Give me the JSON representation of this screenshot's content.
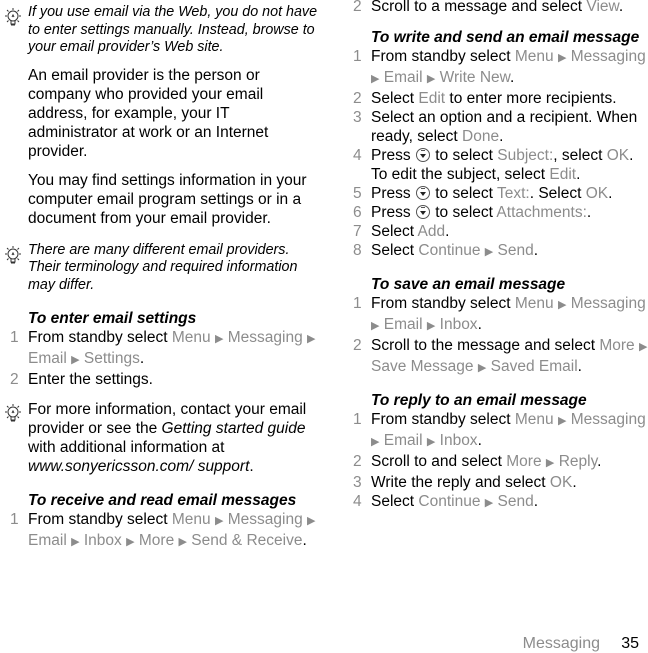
{
  "footer": {
    "section": "Messaging",
    "page_number": "35"
  },
  "left_column": {
    "tip1": "If you use email via the Web, you do not have to enter settings manually. Instead, browse to your email provider’s Web site.",
    "para1": "An email provider is the person or company who provided your email address, for example, your IT administrator at work or an Internet provider.",
    "para2": "You may find settings information in your computer email program settings or in a document from your email provider.",
    "tip2": "There are many different email providers. Their terminology and required information may differ.",
    "enter_settings": {
      "heading": "To enter email settings",
      "steps": [
        {
          "num": "1",
          "pre": "From standby select ",
          "path": [
            "Menu",
            "Messaging",
            "Email",
            "Settings"
          ],
          "post": "."
        },
        {
          "num": "2",
          "text": "Enter the settings."
        }
      ]
    },
    "tip3": {
      "pre": "For more information, contact your email provider or see the ",
      "guide": "Getting started guide",
      "mid": " with additional information at ",
      "url": "www.sonyericsson.com/ support",
      "post": "."
    },
    "receive": {
      "heading": "To receive and read email messages",
      "steps": [
        {
          "num": "1",
          "pre": "From standby select ",
          "path": [
            "Menu",
            "Messaging",
            "Email",
            "Inbox",
            "More",
            "Send & Receive"
          ],
          "post": "."
        }
      ]
    }
  },
  "right_column": {
    "receive_step2": {
      "num": "2",
      "pre": "Scroll to a message and select ",
      "hl": "View",
      "post": "."
    },
    "write": {
      "heading": "To write and send an email message",
      "steps": [
        {
          "num": "1",
          "pre": "From standby select ",
          "path": [
            "Menu",
            "Messaging",
            "Email",
            "Write New"
          ],
          "post": "."
        },
        {
          "num": "2",
          "pre": "Select ",
          "hl": "Edit",
          "post": " to enter more recipients."
        },
        {
          "num": "3",
          "pre": "Select an option and a recipient. When ready, select ",
          "hl": "Done",
          "post": "."
        },
        {
          "num": "4",
          "a": "Press ",
          "b": " to select ",
          "hl1": "Subject:",
          "c": ", select ",
          "hl2": "OK",
          "d": ". To edit the subject, select ",
          "hl3": "Edit",
          "e": "."
        },
        {
          "num": "5",
          "a": "Press ",
          "b": " to select ",
          "hl1": "Text:",
          "c": ". Select ",
          "hl2": "OK",
          "d": "."
        },
        {
          "num": "6",
          "a": "Press ",
          "b": " to select ",
          "hl1": "Attachments:",
          "d": "."
        },
        {
          "num": "7",
          "pre": "Select ",
          "hl": "Add",
          "post": "."
        },
        {
          "num": "8",
          "pre": "Select ",
          "path": [
            "Continue",
            "Send"
          ],
          "post": "."
        }
      ]
    },
    "save": {
      "heading": "To save an email message",
      "steps": [
        {
          "num": "1",
          "pre": "From standby select ",
          "path": [
            "Menu",
            "Messaging",
            "Email",
            "Inbox"
          ],
          "post": "."
        },
        {
          "num": "2",
          "pre": "Scroll to the message and select ",
          "path": [
            "More",
            "Save Message",
            "Saved Email"
          ],
          "post": "."
        }
      ]
    },
    "reply": {
      "heading": "To reply to an email message",
      "steps": [
        {
          "num": "1",
          "pre": "From standby select ",
          "path": [
            "Menu",
            "Messaging",
            "Email",
            "Inbox"
          ],
          "post": "."
        },
        {
          "num": "2",
          "pre": "Scroll to and select ",
          "path": [
            "More",
            "Reply"
          ],
          "post": "."
        },
        {
          "num": "3",
          "pre": "Write the reply and select ",
          "hl": "OK",
          "post": "."
        },
        {
          "num": "4",
          "pre": "Select ",
          "path": [
            "Continue",
            "Send"
          ],
          "post": "."
        }
      ]
    }
  },
  "symbols": {
    "arrow": "▶",
    "navigation_key_icon": "nav-key-down-icon",
    "tip_icon": "lightbulb-icon"
  }
}
